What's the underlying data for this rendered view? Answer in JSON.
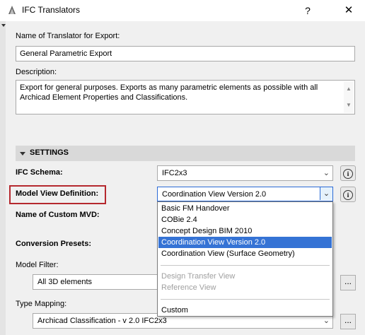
{
  "window": {
    "title": "IFC Translators",
    "help_label": "?",
    "close_label": "✕"
  },
  "form": {
    "name_label": "Name of Translator for Export:",
    "name_value": "General Parametric Export",
    "description_label": "Description:",
    "description_value": "Export for general purposes. Exports as many parametric elements as possible with all Archicad Element Properties and Classifications."
  },
  "settings": {
    "header": "SETTINGS",
    "ifc_schema_label": "IFC Schema:",
    "ifc_schema_value": "IFC2x3",
    "mvd_label": "Model View Definition:",
    "mvd_value": "Coordination View Version 2.0",
    "custom_mvd_label": "Name of Custom MVD:",
    "conversion_presets_label": "Conversion Presets:",
    "model_filter_label": "Model Filter:",
    "model_filter_value": "All 3D elements",
    "type_mapping_label": "Type Mapping:",
    "type_mapping_value": "Archicad Classification - v 2.0 IFC2x3",
    "ellipsis_label": "...",
    "info_label": "i"
  },
  "dropdown": {
    "options": [
      {
        "label": "Basic FM Handover",
        "state": "normal"
      },
      {
        "label": "COBie 2.4",
        "state": "normal"
      },
      {
        "label": "Concept Design BIM 2010",
        "state": "normal"
      },
      {
        "label": "Coordination View Version 2.0",
        "state": "selected"
      },
      {
        "label": "Coordination View (Surface Geometry)",
        "state": "normal"
      },
      {
        "label": "Design Transfer View",
        "state": "disabled"
      },
      {
        "label": "Reference View",
        "state": "disabled"
      },
      {
        "label": "Custom",
        "state": "normal"
      }
    ]
  },
  "colors": {
    "highlight_border": "#b5282e",
    "selected_option": "#3573d5",
    "focus_border": "#2b6ad6"
  }
}
